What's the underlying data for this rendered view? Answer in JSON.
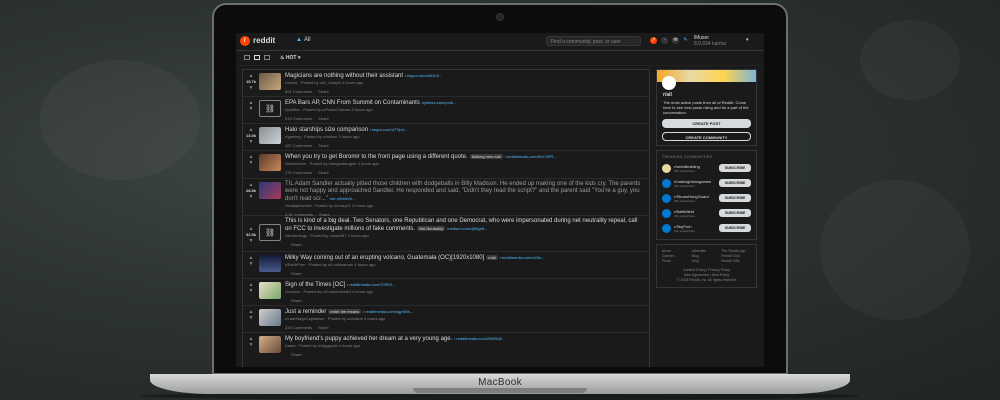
{
  "device": {
    "brand": "MacBook"
  },
  "header": {
    "logo_glyph": "r",
    "wordmark": "reddit",
    "nav_label": "All",
    "search_placeholder": "Find a community, post, or user",
    "username": "lMuser",
    "karma": "8,0,694 karma",
    "accent": "#ff4500",
    "link_color": "#4fbcff"
  },
  "subbar": {
    "sort": "HOT"
  },
  "posts": [
    {
      "votes": "15.7k",
      "thumb": "image",
      "title": "Magicians are nothing without their assistant",
      "domain": "i.imgur.com/d4t1h0...",
      "flair": "",
      "meta": "r/funny · Posted by u/A_Joseph 2 hours ago",
      "comments": "691 Comments",
      "share": "Share"
    },
    {
      "votes": "",
      "thumb": "link",
      "title": "EPA Bars AP, CNN From Summit on Contaminants",
      "domain": "nytimes.com/polit...",
      "flair": "",
      "meta": "r/politics · Posted by u/PowerCanvas 3 hours ago",
      "comments": "919 Comments",
      "share": "Share"
    },
    {
      "votes": "13.0k",
      "thumb": "image",
      "title": "Halo starships size comparison",
      "domain": "i.imgur.com/d7Tlpd...",
      "flair": "",
      "meta": "r/gaming · Posted by u/ahlum 3 hours ago",
      "comments": "487 Comments",
      "share": "Share"
    },
    {
      "votes": "",
      "thumb": "image",
      "title": "When you try to get Boromir to the front page using a different quote.",
      "domain": "i.redditmedia.com/N9C3PR...",
      "flair": "Making new rule",
      "meta": "r/lotrmemes · Posted by u/Imgoofangper 4 hours ago",
      "comments": "176 Comments",
      "share": "Share"
    },
    {
      "votes": "28.8k",
      "thumb": "image",
      "title": "TIL Adam Sandler actually pitted those children with dodgeballs in Billy Madison. He ended up making one of the kids cry. The parents were not happy and approached Sandler. He responded and said, \"Didn't they read the script?\" and the parent said \"You're a guy, you don't read scr...\"",
      "domain": "me.n/fvhsVh...",
      "flair": "",
      "meta": "r/todayilearned · Posted by u/crazy11 4 hours ago",
      "comments": "3.9k Comments",
      "share": "Share"
    },
    {
      "votes": "32.5k",
      "thumb": "link",
      "title": "This is kind of a big deal. Two Senators, one Republican and one Democrat, who were impersonated during net neutrality repeal, call on FCC to investigate millions of fake comments.",
      "domain": "medium.com/@fightf...",
      "flair": "Net Neutrality",
      "meta": "r/technology · Posted by u/lawn0fT 4 hours ago",
      "comments": "",
      "share": "Share"
    },
    {
      "votes": "",
      "thumb": "image",
      "title": "Milky Way coming out of an erupting volcano, Guatemala (OC)[1920x1080]",
      "domain": "i.redditmedia.com/uGtn...",
      "flair": "/r/all",
      "meta": "r/EarthPorn · Posted by u/Lookinaroun 4 hours ago",
      "comments": "",
      "share": "Share"
    },
    {
      "votes": "",
      "thumb": "image",
      "title": "Sign of the Times [OC]",
      "domain": "i.redditmedia.com/TOR0t...",
      "flair": "",
      "meta": "r/comics · Posted by u/ConnectiveArt 4 hours ago",
      "comments": "",
      "share": "Share"
    },
    {
      "votes": "",
      "thumb": "image",
      "title": "Just a reminder",
      "domain": "i.redditmedia.com/4gpN5s...",
      "flair": "enter the means",
      "meta": "r/LateStageCapitalism · Posted by u/chalem 5 hours ago",
      "comments": "226 Comments",
      "share": "Share"
    },
    {
      "votes": "",
      "thumb": "image",
      "title": "My boyfriend's puppy achieved her dream at a very young age.",
      "domain": "i.redditmedia.com/2ld9Rq9...",
      "flair": "",
      "meta": "r/aww · Posted by u/ziggyzzie 4 hours ago",
      "comments": "",
      "share": "Share"
    }
  ],
  "sidebar": {
    "all": {
      "name": "r/all",
      "description": "The most active posts from all of Reddit. Come here to see new posts rising and be a part of the conversation.",
      "create_post": "CREATE POST",
      "create_community": "CREATE COMMUNITY"
    },
    "trending_header": "TRENDING COMMUNITIES",
    "communities": [
      {
        "name": "r/worldbuilding",
        "subs": "56k subscribers",
        "action": "SUBSCRIBE"
      },
      {
        "name": "r/makinghistorgames",
        "subs": "21k subscribers",
        "action": "SUBSCRIBE"
      },
      {
        "name": "r/ShuanHongGuard",
        "subs": "35k subscribers",
        "action": "SUBSCRIBE"
      },
      {
        "name": "r/Battlefield",
        "subs": "24k subscribers",
        "action": "SUBSCRIBE"
      },
      {
        "name": "r/SkyPorn",
        "subs": "31k subscribers",
        "action": "SUBSCRIBE"
      }
    ],
    "footer_links": [
      "About",
      "Advertise",
      "The Reddit App",
      "Careers",
      "Blog",
      "Reddit Gold",
      "Press",
      "Help",
      "Reddit Gifts"
    ],
    "footer_legal": [
      "Content Policy | Privacy Policy",
      "User Agreement | Mod Policy",
      "© 2018 Reddit, Inc. All rights reserved"
    ]
  }
}
